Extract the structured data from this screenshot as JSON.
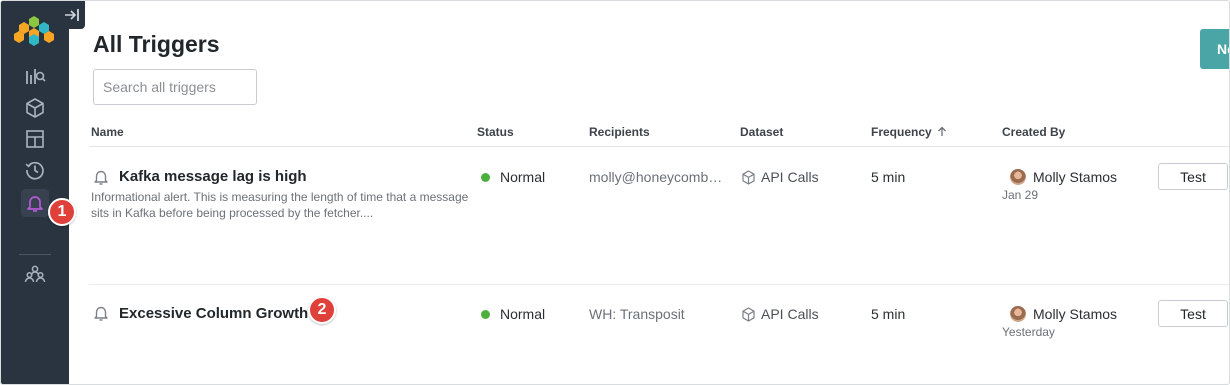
{
  "page": {
    "title": "All Triggers"
  },
  "search": {
    "placeholder": "Search all triggers"
  },
  "new_button": {
    "label": "Ne"
  },
  "columns": {
    "name": "Name",
    "status": "Status",
    "recipients": "Recipients",
    "dataset": "Dataset",
    "frequency": "Frequency",
    "created_by": "Created By"
  },
  "sort_icon": "arrow-up-icon",
  "triggers": [
    {
      "name": "Kafka message lag is high",
      "description": "Informational alert. This is measuring the length of time that a message sits in Kafka before being processed by the fetcher....",
      "status": "Normal",
      "recipients": "molly@honeycomb…",
      "dataset": "API Calls",
      "frequency": "5 min",
      "creator": "Molly Stamos",
      "created": "Jan 29",
      "test_label": "Test"
    },
    {
      "name": "Excessive Column Growth",
      "description": "",
      "status": "Normal",
      "recipients": "WH: Transposit",
      "dataset": "API Calls",
      "frequency": "5 min",
      "creator": "Molly Stamos",
      "created": "Yesterday",
      "test_label": "Test"
    }
  ],
  "badges": {
    "first": "1",
    "second": "2"
  },
  "colors": {
    "sidebar": "#2a3340",
    "accent": "#4aa6a6",
    "status_ok": "#4caf3d",
    "badge": "#e0403a",
    "active_icon": "#b45ad6"
  },
  "sidebar_icons": [
    "query-builder-icon",
    "datasets-icon",
    "boards-icon",
    "history-icon",
    "triggers-bell-icon",
    "team-icon"
  ]
}
